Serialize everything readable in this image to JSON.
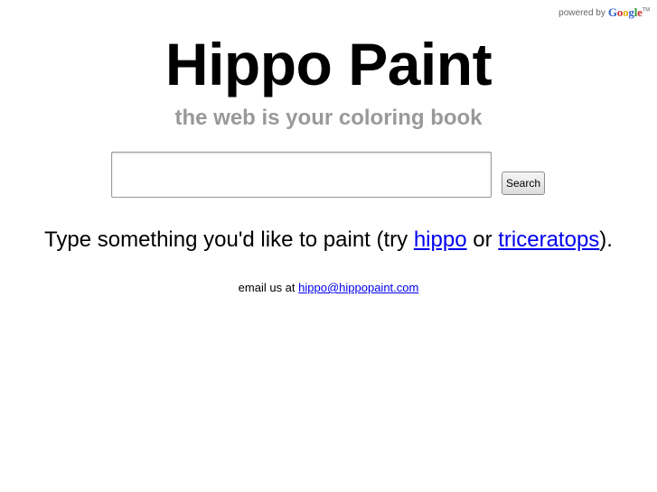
{
  "powered_by": {
    "label": "powered by",
    "logo_letters": [
      "G",
      "o",
      "o",
      "g",
      "l",
      "e"
    ],
    "trademark": "TM"
  },
  "header": {
    "title": "Hippo Paint",
    "subtitle": "the web is your coloring book"
  },
  "search": {
    "value": "",
    "placeholder": "",
    "button_label": "Search"
  },
  "prompt": {
    "prefix": "Type something you'd like to paint (try",
    "link1": "hippo",
    "middle": "or",
    "link2": "triceratops",
    "suffix": ")."
  },
  "footer": {
    "email_prefix": "email us at",
    "email": "hippo@hippopaint.com"
  },
  "colors": {
    "subtitle": "#999999",
    "link": "#0000ee",
    "text": "#000000"
  }
}
